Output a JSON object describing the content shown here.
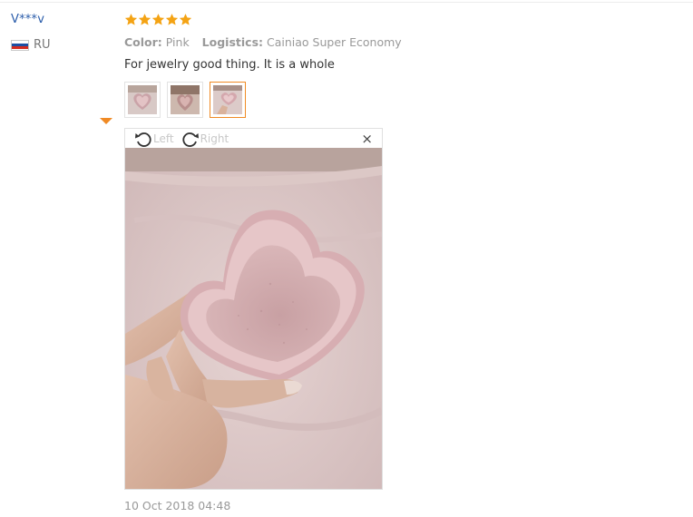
{
  "reviewer": {
    "name": "V***v",
    "country_code": "RU",
    "flag_colors": [
      "#ffffff",
      "#1d4fa3",
      "#d52b1e"
    ]
  },
  "review": {
    "rating": 5,
    "star_color": "#f4a314",
    "color_label": "Color:",
    "color_value": "Pink",
    "logistics_label": "Logistics:",
    "logistics_value": "Cainiao Super Economy",
    "text": "For jewelry good thing. It is a whole",
    "date": "10 Oct 2018 04:48"
  },
  "thumbnails": [
    {
      "icon": "heart-dish-photo"
    },
    {
      "icon": "heart-dish-photo"
    },
    {
      "icon": "heart-dish-photo",
      "selected": true
    }
  ],
  "viewer": {
    "rotate_left_label": "Left",
    "rotate_right_label": "Right",
    "close_icon": "×",
    "photo_icon": "heart-dish-photo"
  },
  "colors": {
    "accent": "#f08a24",
    "link": "#2a5caa"
  }
}
